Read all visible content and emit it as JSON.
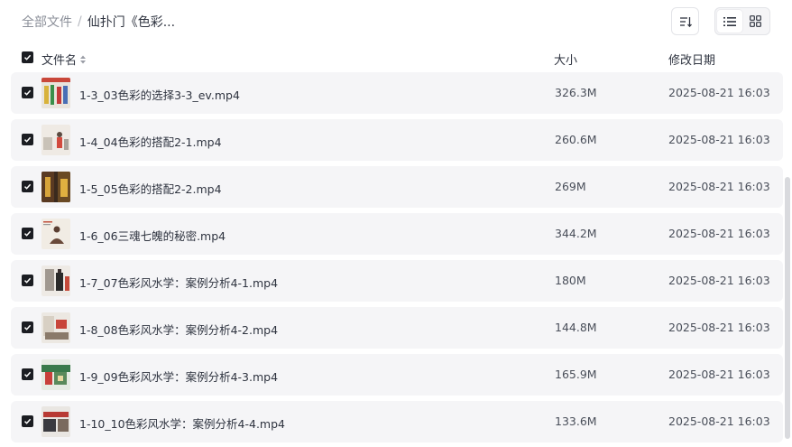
{
  "breadcrumb": {
    "root": "全部文件",
    "separator": "/",
    "current": "仙扑门《色彩..."
  },
  "toolbar": {
    "sort_icon": "sort-icon",
    "list_view_icon": "list-view-icon",
    "grid_view_icon": "grid-view-icon",
    "active_view": "list"
  },
  "table": {
    "columns": {
      "name": "文件名",
      "size": "大小",
      "date": "修改日期"
    },
    "rows": [
      {
        "name": "1-3_03色彩的选择3-3_ev.mp4",
        "size": "326.3M",
        "date": "2025-08-21 16:03",
        "checked": true
      },
      {
        "name": "1-4_04色彩的搭配2-1.mp4",
        "size": "260.6M",
        "date": "2025-08-21 16:03",
        "checked": true
      },
      {
        "name": "1-5_05色彩的搭配2-2.mp4",
        "size": "269M",
        "date": "2025-08-21 16:03",
        "checked": true
      },
      {
        "name": "1-6_06三魂七魄的秘密.mp4",
        "size": "344.2M",
        "date": "2025-08-21 16:03",
        "checked": true
      },
      {
        "name": "1-7_07色彩风水学：案例分析4-1.mp4",
        "size": "180M",
        "date": "2025-08-21 16:03",
        "checked": true
      },
      {
        "name": "1-8_08色彩风水学：案例分析4-2.mp4",
        "size": "144.8M",
        "date": "2025-08-21 16:03",
        "checked": true
      },
      {
        "name": "1-9_09色彩风水学：案例分析4-3.mp4",
        "size": "165.9M",
        "date": "2025-08-21 16:03",
        "checked": true
      },
      {
        "name": "1-10_10色彩风水学：案例分析4-4.mp4",
        "size": "133.6M",
        "date": "2025-08-21 16:03",
        "checked": true
      }
    ]
  },
  "colors": {
    "row_bg": "#f5f5f7",
    "checkbox": "#1b1d22",
    "text": "#2f3440",
    "muted": "#8b8f99"
  }
}
